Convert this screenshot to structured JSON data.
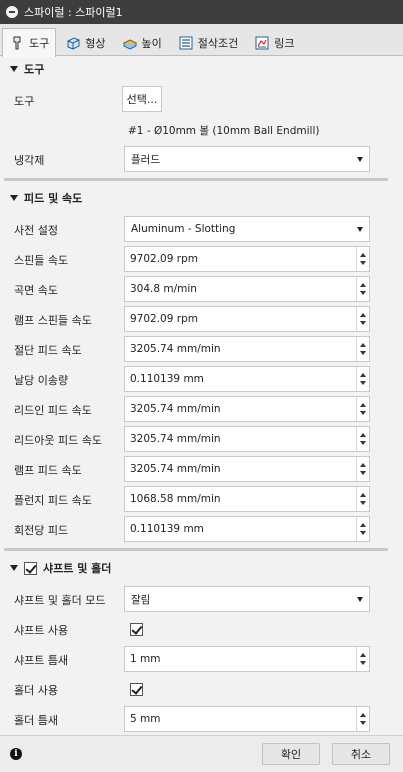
{
  "window": {
    "title": "스파이럴 : 스파이럴1"
  },
  "tabs": [
    {
      "label": "도구",
      "icon": "tool-icon",
      "active": true
    },
    {
      "label": "형상",
      "icon": "geometry-icon"
    },
    {
      "label": "높이",
      "icon": "heights-icon"
    },
    {
      "label": "절삭조건",
      "icon": "passes-icon"
    },
    {
      "label": "링크",
      "icon": "linking-icon"
    }
  ],
  "tool_section": {
    "header": "도구",
    "tool_label": "도구",
    "select_button": "선택...",
    "tool_name": "#1 - Ø10mm 볼 (10mm Ball Endmill)",
    "coolant_label": "냉각제",
    "coolant_value": "플러드"
  },
  "feed_section": {
    "header": "피드 및 속도",
    "preset_label": "사전 설정",
    "preset_value": "Aluminum - Slotting",
    "fields": [
      {
        "label": "스핀들 속도",
        "value": "9702.09 rpm"
      },
      {
        "label": "곡면 속도",
        "value": "304.8 m/min"
      },
      {
        "label": "램프 스핀들 속도",
        "value": "9702.09 rpm"
      },
      {
        "label": "절단 피드 속도",
        "value": "3205.74 mm/min"
      },
      {
        "label": "날당 이송량",
        "value": "0.110139 mm"
      },
      {
        "label": "리드인 피드 속도",
        "value": "3205.74 mm/min"
      },
      {
        "label": "리드아웃 피드 속도",
        "value": "3205.74 mm/min"
      },
      {
        "label": "램프 피드 속도",
        "value": "3205.74 mm/min"
      },
      {
        "label": "플런지 피드 속도",
        "value": "1068.58 mm/min"
      },
      {
        "label": "회전당 피드",
        "value": "0.110139 mm"
      }
    ]
  },
  "shaft_section": {
    "header": "샤프트 및 홀더",
    "mode_label": "샤프트 및 홀더 모드",
    "mode_value": "잘림",
    "use_shaft_label": "샤프트 사용",
    "shaft_clearance_label": "샤프트 틈새",
    "shaft_clearance_value": "1 mm",
    "use_holder_label": "홀더 사용",
    "holder_clearance_label": "홀더 틈새",
    "holder_clearance_value": "5 mm"
  },
  "footer": {
    "ok": "확인",
    "cancel": "취소"
  }
}
